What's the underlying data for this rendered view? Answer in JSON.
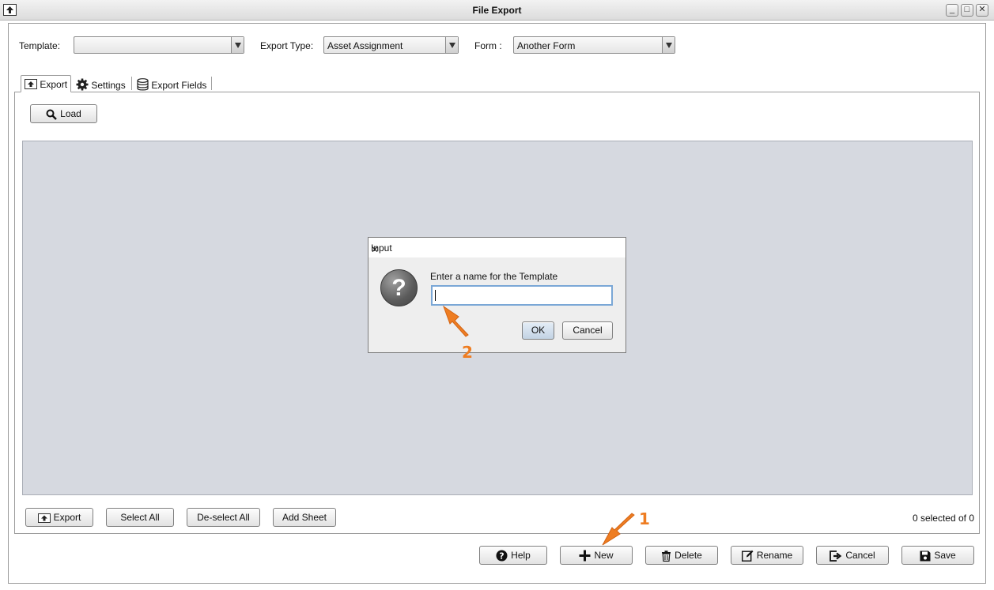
{
  "window": {
    "title": "File Export"
  },
  "top": {
    "template_label": "Template:",
    "template_value": "",
    "export_type_label": "Export Type:",
    "export_type_value": "Asset Assignment",
    "form_label": "Form :",
    "form_value": "Another Form"
  },
  "tabs": [
    {
      "label": "Export",
      "icon": "export-icon"
    },
    {
      "label": "Settings",
      "icon": "gear-icon"
    },
    {
      "label": "Export Fields",
      "icon": "database-icon"
    }
  ],
  "panel": {
    "load_label": "Load",
    "export_label": "Export",
    "select_all_label": "Select All",
    "deselect_all_label": "De-select All",
    "add_sheet_label": "Add Sheet",
    "status": "0 selected of 0"
  },
  "footer": {
    "help_label": "Help",
    "new_label": "New",
    "delete_label": "Delete",
    "rename_label": "Rename",
    "cancel_label": "Cancel",
    "save_label": "Save"
  },
  "dialog": {
    "title": "Input",
    "message": "Enter a name for the Template",
    "input_value": "",
    "ok_label": "OK",
    "cancel_label": "Cancel"
  },
  "annotations": {
    "step1": "1",
    "step2": "2",
    "color": "#EE7D22"
  }
}
